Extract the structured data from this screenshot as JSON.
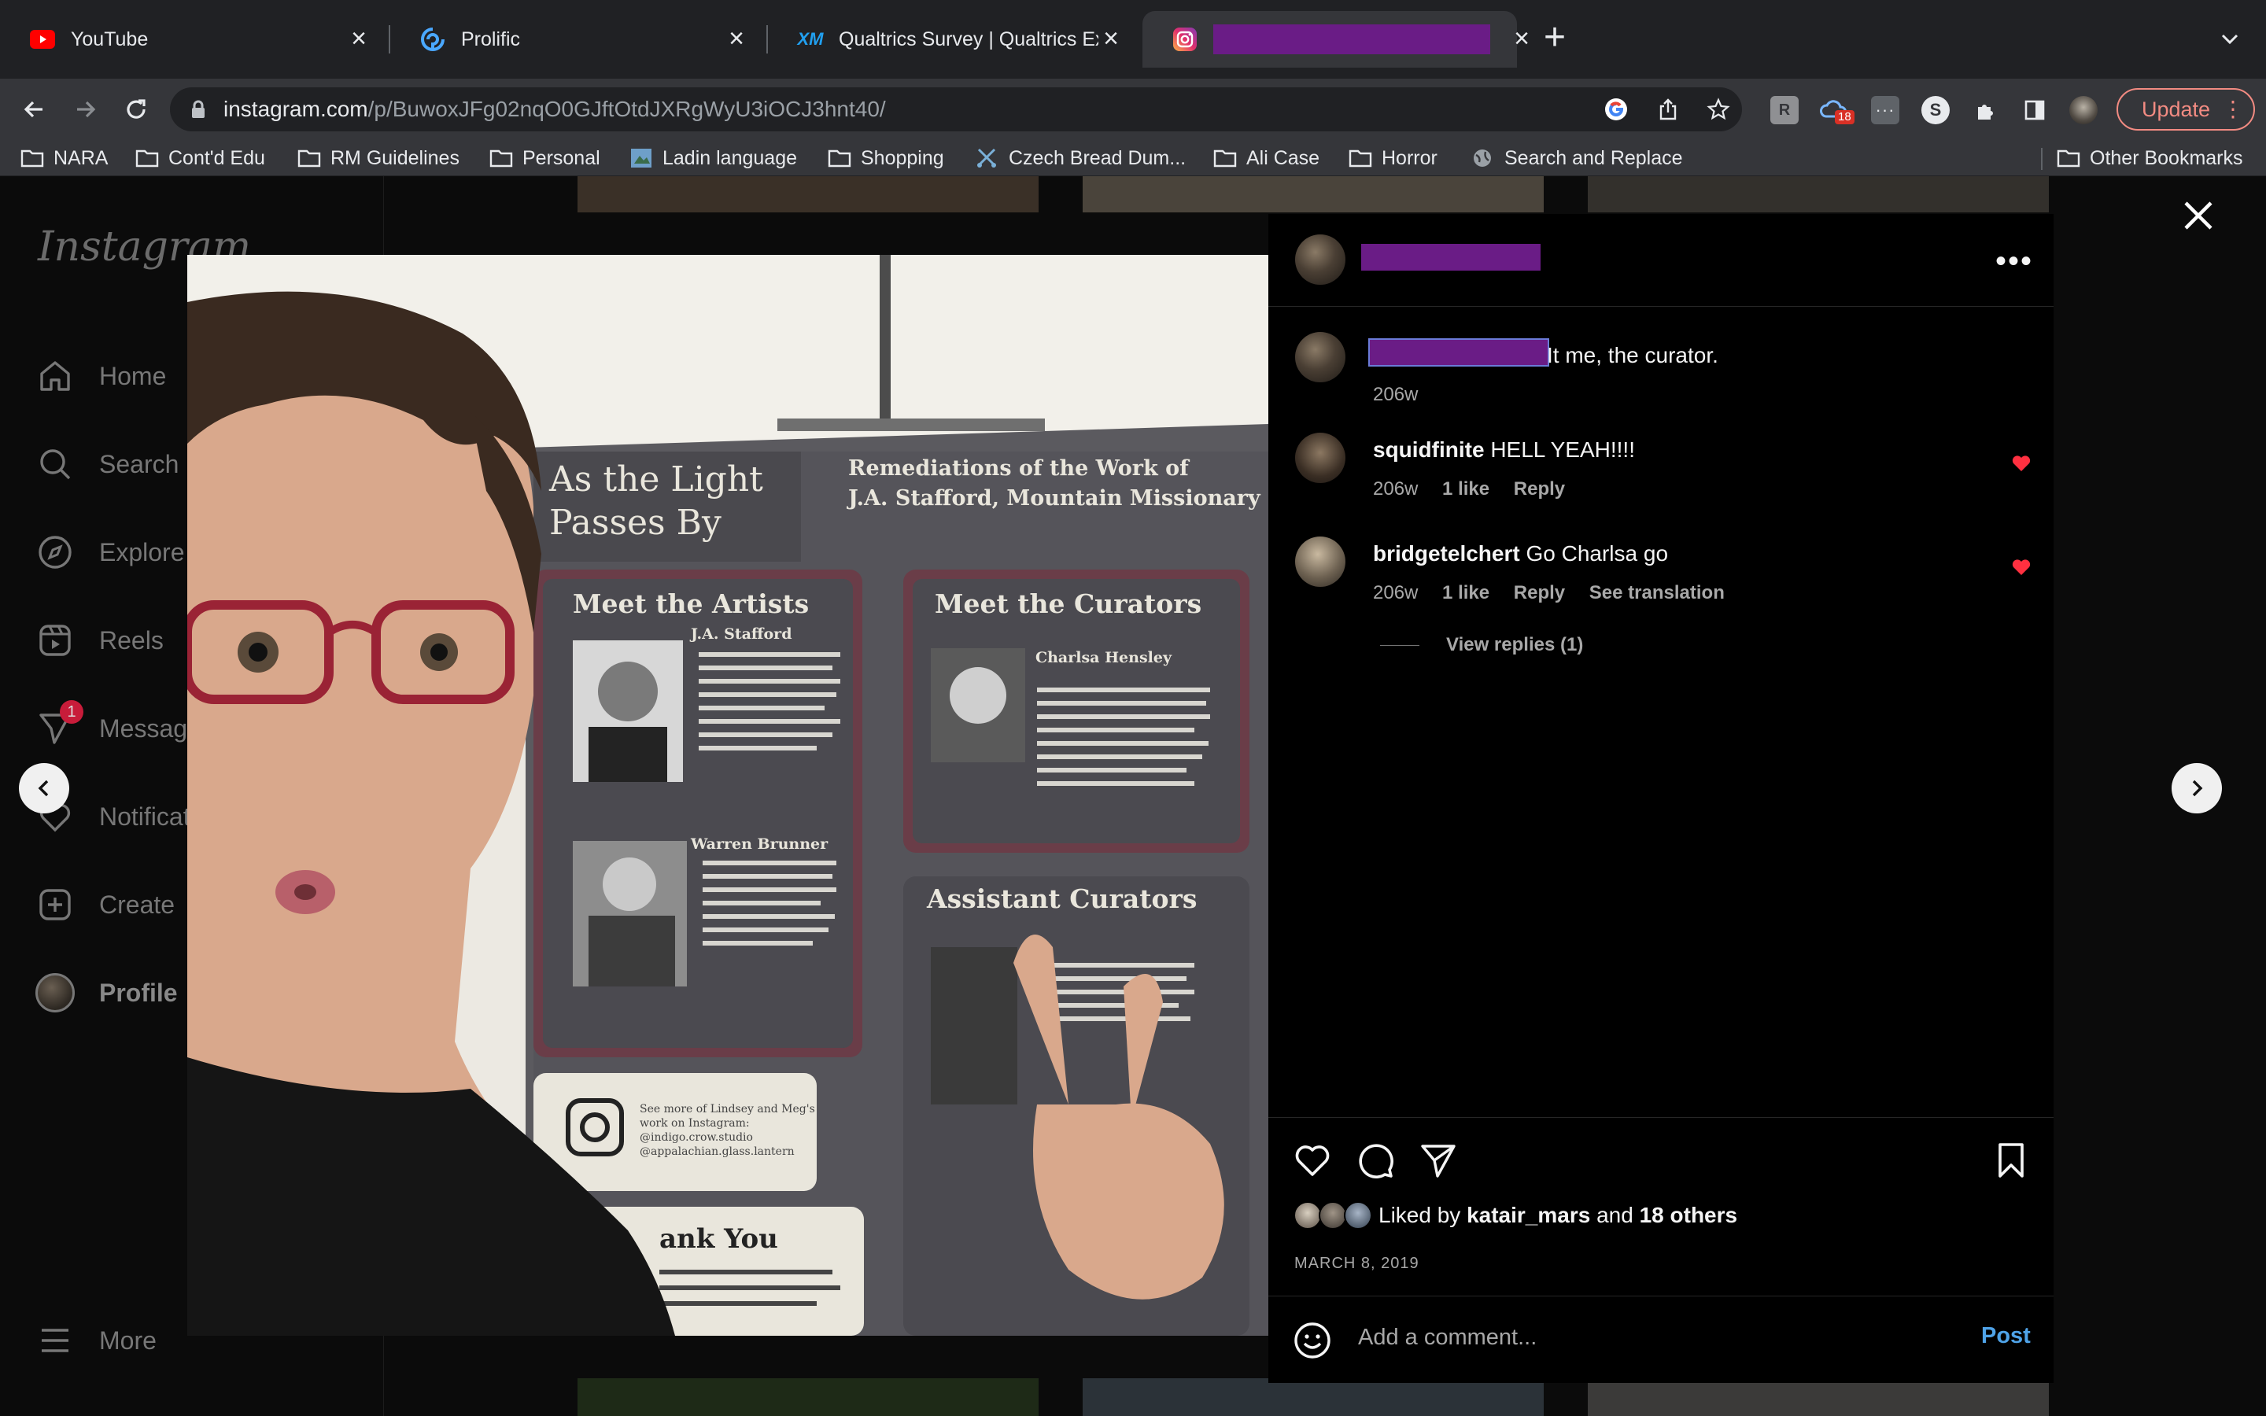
{
  "browser": {
    "tabs": [
      {
        "title": "YouTube"
      },
      {
        "title": "Prolific"
      },
      {
        "title": "Qualtrics Survey | Qualtrics Experience Management"
      },
      {
        "title": ""
      }
    ],
    "url_host": "instagram.com",
    "url_path": "/p/BuwoxJFg02nqO0GJftOtdJXRgWyU3iOCJ3hnt40/",
    "update_label": "Update",
    "extension_badge": "18",
    "bookmarks": [
      {
        "label": "NARA",
        "icon": "folder-icon"
      },
      {
        "label": "Cont'd Edu",
        "icon": "folder-icon"
      },
      {
        "label": "RM Guidelines",
        "icon": "folder-icon"
      },
      {
        "label": "Personal",
        "icon": "folder-icon"
      },
      {
        "label": "Ladin language",
        "icon": "image-icon"
      },
      {
        "label": "Shopping",
        "icon": "folder-icon"
      },
      {
        "label": "Czech Bread Dum...",
        "icon": "scissors-icon"
      },
      {
        "label": "Ali Case",
        "icon": "folder-icon"
      },
      {
        "label": "Horror",
        "icon": "folder-icon"
      },
      {
        "label": "Search and Replace",
        "icon": "globe-icon"
      }
    ],
    "other_bookmarks": "Other Bookmarks"
  },
  "instagram": {
    "logo": "Instagram",
    "nav": [
      {
        "label": "Home",
        "icon": "home-icon"
      },
      {
        "label": "Search",
        "icon": "search-icon"
      },
      {
        "label": "Explore",
        "icon": "compass-icon"
      },
      {
        "label": "Reels",
        "icon": "reels-icon"
      },
      {
        "label": "Messages",
        "icon": "messenger-icon",
        "badge": "1"
      },
      {
        "label": "Notifications",
        "icon": "heart-icon"
      },
      {
        "label": "Create",
        "icon": "plus-square-icon"
      },
      {
        "label": "Profile",
        "icon": "avatar"
      }
    ],
    "more_label": "More"
  },
  "post": {
    "caption_text": "It me, the curator.",
    "caption_time": "206w",
    "comments": [
      {
        "user": "squidfinite",
        "text": "HELL YEAH!!!!",
        "time": "206w",
        "likes": "1 like",
        "reply": "Reply",
        "liked": true
      },
      {
        "user": "bridgetelchert",
        "text": "Go Charlsa go",
        "time": "206w",
        "likes": "1 like",
        "reply": "Reply",
        "translate": "See translation",
        "liked": true
      }
    ],
    "view_replies": "View replies (1)",
    "liked_by_prefix": "Liked by",
    "liked_by_user": "katair_mars",
    "liked_by_and": "and",
    "liked_by_others": "18 others",
    "date": "MARCH 8, 2019",
    "comment_placeholder": "Add a comment...",
    "post_label": "Post"
  },
  "colors": {
    "accent": "#4fa3e8",
    "like_red": "#ff3040",
    "redaction": "#6a1c86"
  }
}
